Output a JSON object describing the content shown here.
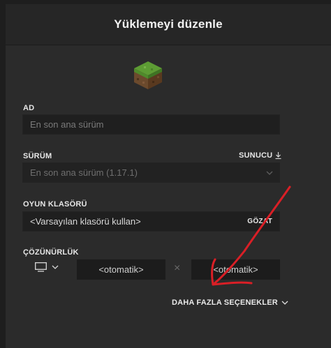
{
  "dialog": {
    "title": "Yüklemeyi düzenle"
  },
  "name_section": {
    "label": "AD",
    "placeholder": "En son ana sürüm"
  },
  "version_section": {
    "label": "SÜRÜM",
    "server_label": "SUNUCU",
    "selected": "En son ana sürüm (1.17.1)"
  },
  "game_folder_section": {
    "label": "OYUN KLASÖRÜ",
    "value": "<Varsayılan klasörü kullan>",
    "browse_label": "GÖZAT"
  },
  "resolution_section": {
    "label": "ÇÖZÜNÜRLÜK",
    "width_value": "<otomatik>",
    "height_value": "<otomatik>",
    "separator": "×"
  },
  "more_options_label": "DAHA FAZLA SEÇENEKLER",
  "colors": {
    "annotation_arrow": "#d91f26",
    "grass_top": "#4f8a2b",
    "dirt": "#6b4a2d"
  },
  "icons": [
    "grass-block-icon",
    "download-icon",
    "chevron-down-icon",
    "monitor-icon",
    "close-icon"
  ]
}
